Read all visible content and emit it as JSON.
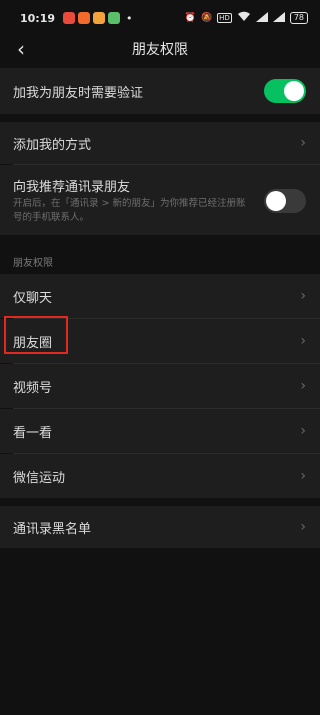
{
  "status_bar": {
    "time": "10:19",
    "dot": "•",
    "icons": [
      "alarm-icon",
      "mute-icon",
      "hd-icon",
      "wifi-icon",
      "signal-icon",
      "signal-icon"
    ],
    "hd_label": "HD",
    "battery": "78"
  },
  "nav": {
    "back_glyph": "‹",
    "title": "朋友权限"
  },
  "settings": {
    "verify_label": "加我为朋友时需要验证",
    "verify_on": true,
    "add_me_label": "添加我的方式",
    "recommend_label": "向我推荐通讯录朋友",
    "recommend_desc": "开启后，在「通讯录 > 新的朋友」为你推荐已经注册账号的手机联系人。",
    "recommend_on": false
  },
  "friend_permissions": {
    "header": "朋友权限",
    "items": [
      {
        "label": "仅聊天"
      },
      {
        "label": "朋友圈"
      },
      {
        "label": "视频号"
      },
      {
        "label": "看一看"
      },
      {
        "label": "微信运动"
      }
    ]
  },
  "blacklist": {
    "label": "通讯录黑名单"
  },
  "colors": {
    "accent_green": "#07c160",
    "highlight_red": "#e02a1f",
    "cell_bg": "#1e1e1e",
    "page_bg": "#111111"
  },
  "chevron_glyph": "›"
}
